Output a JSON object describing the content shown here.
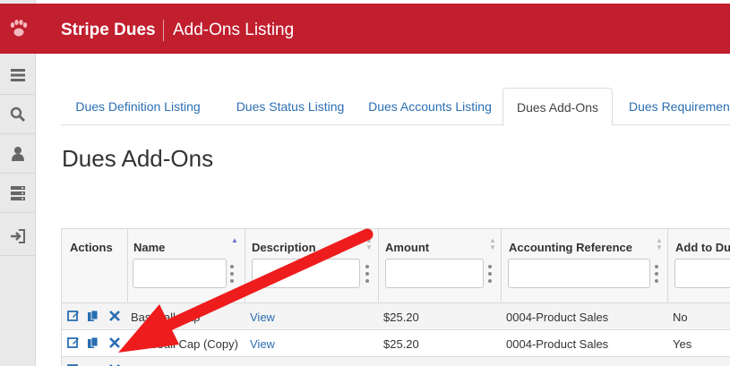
{
  "app": {
    "brand": "Stripe Dues",
    "page_header": "Add-Ons Listing"
  },
  "sidebar": {
    "logo_icon": "paw-icon",
    "items": [
      {
        "icon": "menu-icon"
      },
      {
        "icon": "search-icon"
      },
      {
        "icon": "user-icon"
      },
      {
        "icon": "server-icon"
      },
      {
        "icon": "sign-in-icon"
      }
    ]
  },
  "tabs": [
    {
      "label": "Dues Definition Listing"
    },
    {
      "label": "Dues Status Listing"
    },
    {
      "label": "Dues Accounts Listing"
    },
    {
      "label": "Dues Add-Ons",
      "active": true
    },
    {
      "label": "Dues Requirement"
    }
  ],
  "page_title": "Dues Add-Ons",
  "table": {
    "columns": [
      "Actions",
      "Name",
      "Description",
      "Amount",
      "Accounting Reference",
      "Add to Du"
    ],
    "rows": [
      {
        "name": "Baseball Cap",
        "description": "View",
        "amount": "$25.20",
        "accounting": "0004-Product Sales",
        "add": "No"
      },
      {
        "name": "Baseball Cap (Copy)",
        "description": "View",
        "amount": "$25.20",
        "accounting": "0004-Product Sales",
        "add": "Yes"
      },
      {
        "name": "",
        "description": "",
        "amount": "",
        "accounting": "",
        "add": ""
      }
    ]
  },
  "colors": {
    "brand_red": "#c11e2e",
    "link_blue": "#2a6eb2",
    "arrow_red": "#ee1c1c"
  }
}
